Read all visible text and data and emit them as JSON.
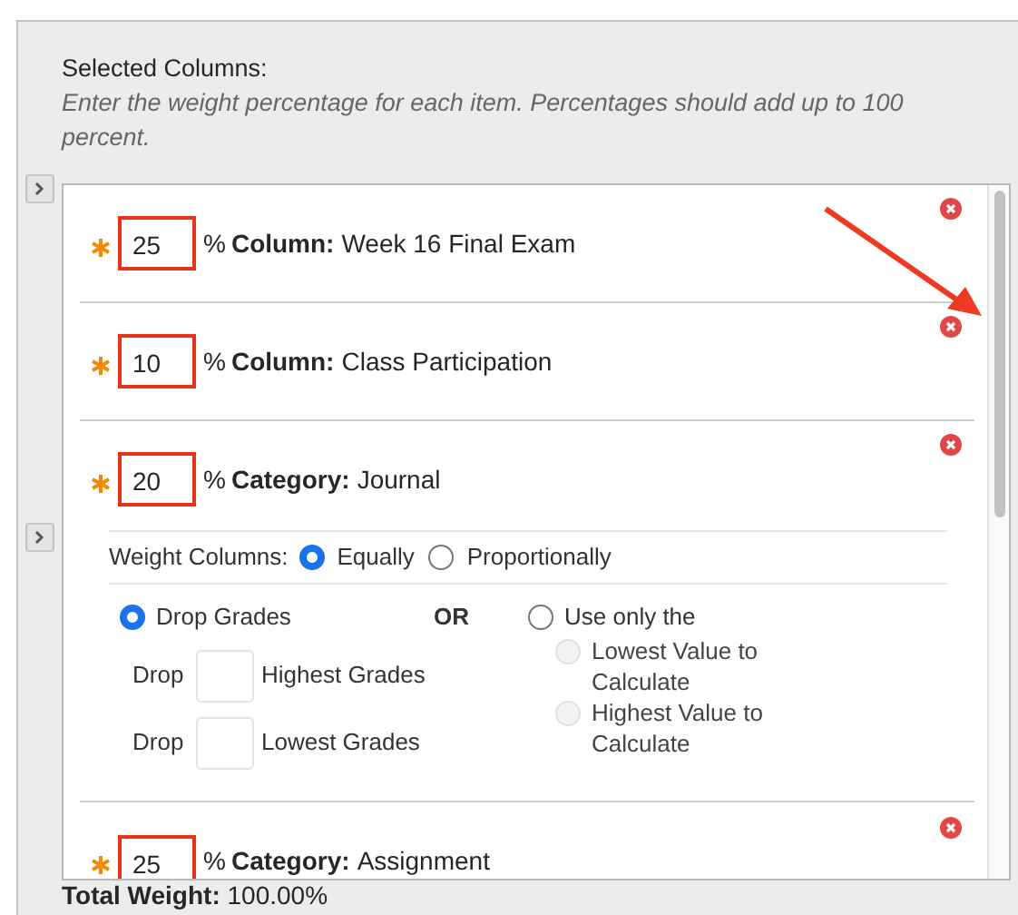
{
  "section": {
    "title": "Selected Columns:",
    "instructions": "Enter the weight percentage for each item. Percentages should add up to 100 percent."
  },
  "items": [
    {
      "kind": "column",
      "weight": "25",
      "unit": "%",
      "type_label": "Column:",
      "name": "Week 16 Final Exam",
      "highlighted": true
    },
    {
      "kind": "column",
      "weight": "10",
      "unit": "%",
      "type_label": "Column:",
      "name": "Class Participation",
      "highlighted": true
    },
    {
      "kind": "category",
      "weight": "20",
      "unit": "%",
      "type_label": "Category:",
      "name": "Journal",
      "highlighted": true,
      "settings": {
        "weight_columns": {
          "label": "Weight Columns:",
          "options": [
            {
              "label": "Equally",
              "selected": true
            },
            {
              "label": "Proportionally",
              "selected": false
            }
          ]
        },
        "drop": {
          "label": "Drop Grades",
          "selected": true,
          "rows": [
            {
              "prefix": "Drop",
              "suffix": "Highest Grades"
            },
            {
              "prefix": "Drop",
              "suffix": "Lowest Grades"
            }
          ]
        },
        "or_label": "OR",
        "use_only": {
          "label": "Use only the",
          "selected": false,
          "options": [
            {
              "label": "Lowest Value to Calculate",
              "selected": false,
              "disabled": true
            },
            {
              "label": "Highest Value to Calculate",
              "selected": false,
              "disabled": true
            }
          ]
        }
      }
    },
    {
      "kind": "category",
      "weight": "25",
      "unit": "%",
      "type_label": "Category:",
      "name": "Assignment",
      "highlighted": true
    }
  ],
  "total": {
    "label": "Total Weight:",
    "value": "100.00%"
  }
}
